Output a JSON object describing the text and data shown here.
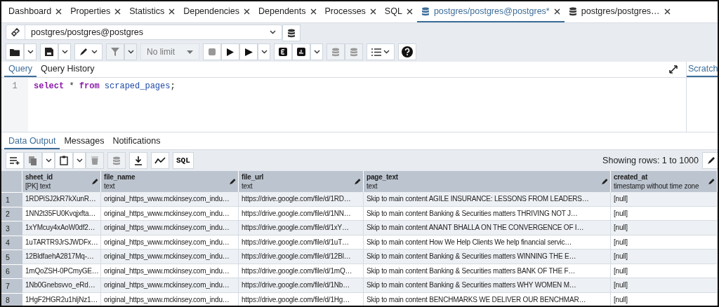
{
  "tabs": [
    {
      "label": "Dashboard",
      "selected": false,
      "db_icon": false
    },
    {
      "label": "Properties",
      "selected": false,
      "db_icon": false
    },
    {
      "label": "Statistics",
      "selected": false,
      "db_icon": false
    },
    {
      "label": "Dependencies",
      "selected": false,
      "db_icon": false
    },
    {
      "label": "Dependents",
      "selected": false,
      "db_icon": false
    },
    {
      "label": "Processes",
      "selected": false,
      "db_icon": false
    },
    {
      "label": "SQL",
      "selected": false,
      "db_icon": false
    },
    {
      "label": "postgres/postgres@postgres*",
      "selected": true,
      "db_icon": true
    },
    {
      "label": "postgres/postgres…",
      "selected": false,
      "db_icon": true
    }
  ],
  "connection": {
    "value": "postgres/postgres@postgres"
  },
  "toolbar": {
    "limit": "No limit"
  },
  "editor_tabs": [
    {
      "label": "Query",
      "selected": true
    },
    {
      "label": "Query History",
      "selected": false
    }
  ],
  "side_tab": {
    "label": "Scratch",
    "selected": true
  },
  "editor": {
    "line_numbers": [
      "1"
    ],
    "tokens": [
      {
        "text": "select",
        "kind": "keyword"
      },
      {
        "text": " * ",
        "kind": "plain"
      },
      {
        "text": "from",
        "kind": "keyword"
      },
      {
        "text": " scraped_pages",
        "kind": "identifier"
      },
      {
        "text": ";",
        "kind": "plain"
      }
    ]
  },
  "result_tabs": [
    {
      "label": "Data Output",
      "selected": true
    },
    {
      "label": "Messages",
      "selected": false
    },
    {
      "label": "Notifications",
      "selected": false
    }
  ],
  "result_toolbar": {
    "sql_button": "SQL",
    "row_info": "Showing rows: 1 to 1000"
  },
  "table": {
    "columns": [
      {
        "name": "sheet_id",
        "type": "[PK] text"
      },
      {
        "name": "file_name",
        "type": "text"
      },
      {
        "name": "file_url",
        "type": "text"
      },
      {
        "name": "page_text",
        "type": "text"
      },
      {
        "name": "created_at",
        "type": "timestamp without time zone"
      }
    ],
    "rows": [
      {
        "num": "1",
        "cells": [
          "1RDPiSJ2kR7kXunR…",
          "original_https_www.mckinsey.com_indu…",
          "https://drive.google.com/file/d/1RD…",
          "Skip to main content AGILE INSURANCE: LESSONS FROM LEADERS…",
          "[null]"
        ]
      },
      {
        "num": "2",
        "cells": [
          "1NN2t35FU0Kvqjxfta…",
          "original_https_www.mckinsey.com_indu…",
          "https://drive.google.com/file/d/1NN…",
          "Skip to main content Banking & Securities matters THRIVING NOT J…",
          "[null]"
        ]
      },
      {
        "num": "3",
        "cells": [
          "1xYMcuy4xAoW0df2…",
          "original_https_www.mckinsey.com_indu…",
          "https://drive.google.com/file/d/1xY…",
          "Skip to main content ANANT BHALLA ON THE CONVERGENCE OF I…",
          "[null]"
        ]
      },
      {
        "num": "4",
        "cells": [
          "1uTARTR9JrSJWDFx…",
          "original_https_www.mckinsey.com_indu…",
          "https://drive.google.com/file/d/1uT…",
          "Skip to main content How We Help Clients  We help financial servic…",
          "[null]"
        ]
      },
      {
        "num": "5",
        "cells": [
          "12BldfaehA2817Mq-…",
          "original_https_www.mckinsey.com_indu…",
          "https://drive.google.com/file/d/12Bl…",
          "Skip to main content Banking & Securities matters WINNING THE E…",
          "[null]"
        ]
      },
      {
        "num": "6",
        "cells": [
          "1mQoZSH-0PCmyGE…",
          "original_https_www.mckinsey.com_indu…",
          "https://drive.google.com/file/d/1mQ…",
          "Skip to main content Banking & Securities matters BANK OF THE F…",
          "[null]"
        ]
      },
      {
        "num": "7",
        "cells": [
          "1Nb0Gnebsvvo_eRd…",
          "original_https_www.mckinsey.com_indu…",
          "https://drive.google.com/file/d/1Nb…",
          "Skip to main content Banking & Securities matters WHY WOMEN M…",
          "[null]"
        ]
      },
      {
        "num": "8",
        "cells": [
          "1HgF2HGR2u1hljNz1…",
          "original_https_www.mckinsey.com_indu…",
          "https://drive.google.com/file/d/1Hg…",
          "Skip to main content BENCHMARKS WE DELIVER OUR BENCHMAR…",
          "[null]"
        ]
      }
    ]
  }
}
